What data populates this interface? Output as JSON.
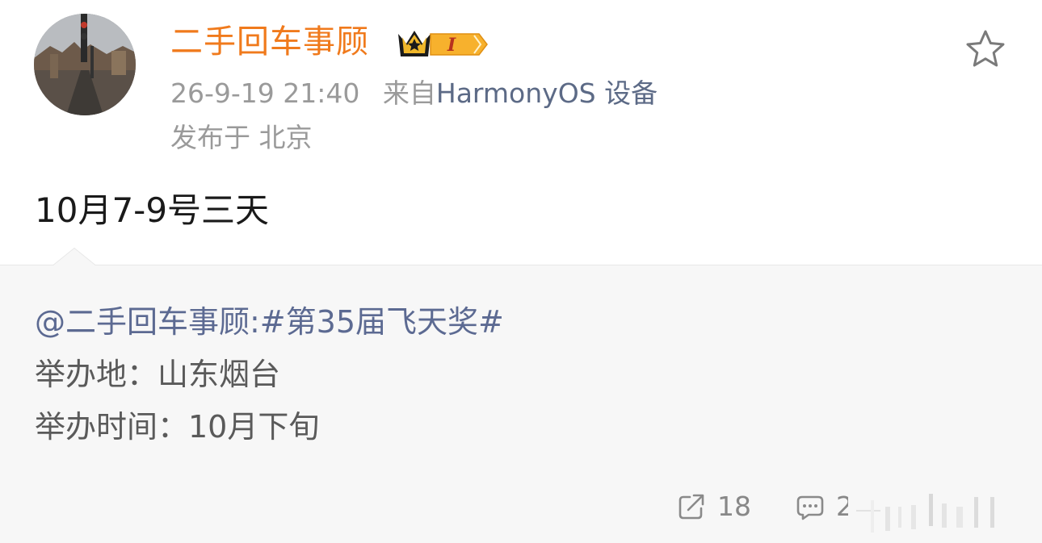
{
  "user": {
    "name": "二手回车事顾",
    "badge_level": "I"
  },
  "meta": {
    "timestamp": "26-9-19 21:40",
    "source_prefix": "来自",
    "device": "HarmonyOS 设备",
    "location": "发布于 北京"
  },
  "post": {
    "text": "10月7-9号三天"
  },
  "repost": {
    "author_topic": "@二手回车事顾:#第35届飞天奖#",
    "venue": "举办地：山东烟台",
    "time": "举办时间：10月下旬"
  },
  "actions": {
    "share_count": "18",
    "comment_count": "2"
  },
  "colors": {
    "username": "#f07a1c",
    "link": "#5c6a92",
    "meta_gray": "#9a9a9a",
    "repost_bg": "#f7f7f7"
  },
  "icons": {
    "favorite": "star-outline-icon",
    "share": "share-icon",
    "comment": "comment-icon",
    "badge": "crown-icon"
  }
}
